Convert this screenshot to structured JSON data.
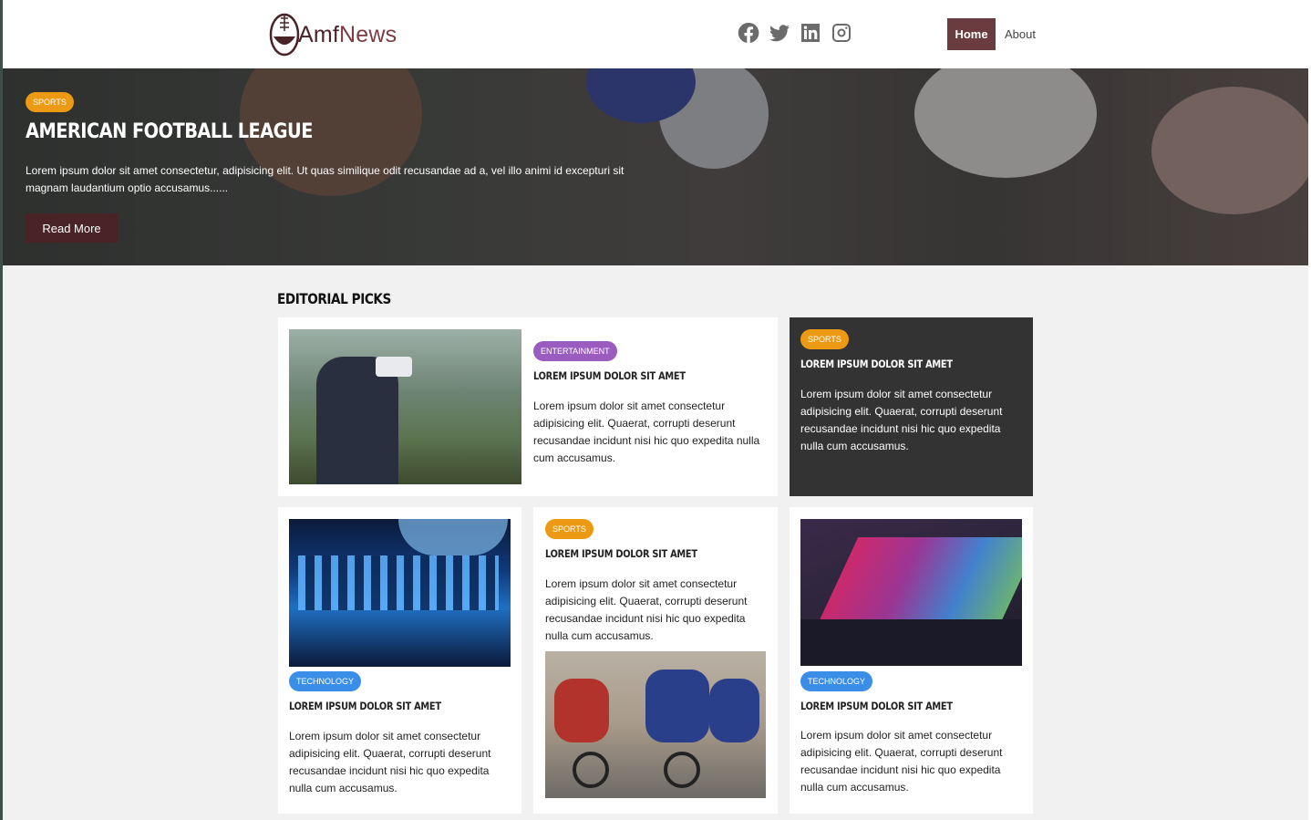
{
  "header": {
    "logo_amf": "Amf",
    "logo_news": "News",
    "nav": {
      "home": "Home",
      "about": "About"
    },
    "social": [
      "facebook-icon",
      "twitter-icon",
      "linkedin-icon",
      "instagram-icon"
    ]
  },
  "hero": {
    "category": "SPORTS",
    "title": "AMERICAN FOOTBALL LEAGUE",
    "text": "Lorem ipsum dolor sit amet consectetur, adipisicing elit. Ut quas similique odit recusandae ad a, vel illo animi id excepturi sit magnam laudantium optio accusamus......",
    "button": "Read More"
  },
  "section": {
    "title": "EDITORIAL PICKS"
  },
  "cards": [
    {
      "category": "ENTERTAINMENT",
      "title": "LOREM IPSUM DOLOR SIT AMET",
      "text": "Lorem ipsum dolor sit amet consectetur adipisicing elit. Quaerat, corrupti deserunt recusandae incidunt nisi hic quo expedita nulla cum accusamus."
    },
    {
      "category": "SPORTS",
      "title": "LOREM IPSUM DOLOR SIT AMET",
      "text": "Lorem ipsum dolor sit amet consectetur adipisicing elit. Quaerat, corrupti deserunt recusandae incidunt nisi hic quo expedita nulla cum accusamus."
    },
    {
      "category": "TECHNOLOGY",
      "title": "LOREM IPSUM DOLOR SIT AMET",
      "text": "Lorem ipsum dolor sit amet consectetur adipisicing elit. Quaerat, corrupti deserunt recusandae incidunt nisi hic quo expedita nulla cum accusamus."
    },
    {
      "category": "SPORTS",
      "title": "LOREM IPSUM DOLOR SIT AMET",
      "text": "Lorem ipsum dolor sit amet consectetur adipisicing elit. Quaerat, corrupti deserunt recusandae incidunt nisi hic quo expedita nulla cum accusamus."
    },
    {
      "category": "TECHNOLOGY",
      "title": "LOREM IPSUM DOLOR SIT AMET",
      "text": "Lorem ipsum dolor sit amet consectetur adipisicing elit. Quaerat, corrupti deserunt recusandae incidunt nisi hic quo expedita nulla cum accusamus."
    }
  ],
  "colors": {
    "brand": "#6a3c3f",
    "sports": "#ec9a14",
    "entertainment": "#9b5cc0",
    "technology": "#3a8ee8"
  }
}
